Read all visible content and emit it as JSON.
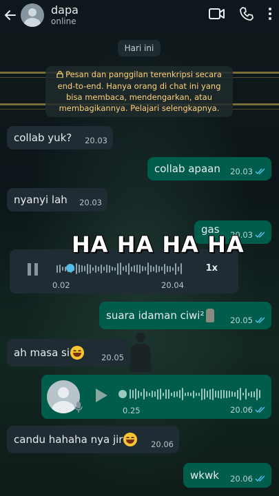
{
  "header": {
    "contact_name": "dapa",
    "status": "online",
    "icons": [
      "back-arrow-icon",
      "video-call-icon",
      "voice-call-icon",
      "more-options-icon"
    ]
  },
  "date_chip": "Hari ini",
  "encryption_notice": "Pesan dan panggilan terenkripsi secara end-to-end. Hanya orang di chat ini yang bisa membaca, mendengarkan, atau membagikannya. Pelajari selengkapnya.",
  "messages": [
    {
      "dir": "in",
      "text": "collab yuk?",
      "time": "20.03"
    },
    {
      "dir": "out",
      "text": "collab apaan",
      "time": "20.03"
    },
    {
      "dir": "in",
      "text": "nyanyi lah",
      "time": "20.03"
    },
    {
      "dir": "out",
      "text": "gas",
      "time": "20.03"
    },
    {
      "dir": "in",
      "type": "voice",
      "elapsed": "0.02",
      "time": "20.04",
      "speed": "1x",
      "progress": 0.08
    },
    {
      "dir": "out",
      "text": "suara idaman ciwi²",
      "time": "20.05"
    },
    {
      "dir": "in",
      "text": "ah masa si",
      "time": "20.05"
    },
    {
      "dir": "out",
      "type": "voice",
      "duration": "0.25",
      "time": "20.06",
      "progress": 0.0
    },
    {
      "dir": "in",
      "text": "candu hahaha nya jir",
      "time": "20.06"
    },
    {
      "dir": "out",
      "text": "wkwk",
      "time": "20.06"
    }
  ],
  "overlay_caption": "HA HA HA HA",
  "colors": {
    "incoming_bubble": "#1f2c33",
    "outgoing_bubble": "#005c4b",
    "notice_text": "#ffd279"
  }
}
